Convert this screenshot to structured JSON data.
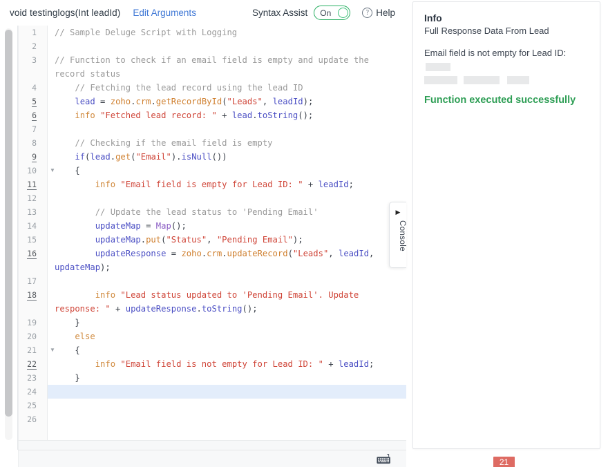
{
  "toolbar": {
    "function_signature": "void testinglogs(Int leadId)",
    "edit_arguments_label": "Edit Arguments",
    "syntax_assist_label": "Syntax Assist",
    "syntax_assist_state": "On",
    "help_label": "Help",
    "help_icon": "question-mark-circle-icon",
    "accent_link_color": "#4179d6",
    "toggle_on_color": "#27ae60"
  },
  "console": {
    "label": "Console",
    "arrow_icon": "triangle-right-icon"
  },
  "footer": {
    "keyboard_icon": "keyboard-icon"
  },
  "badge": {
    "count": "21",
    "color": "#de6b63"
  },
  "info_panel": {
    "title": "Info",
    "subtitle": "Full Response Data From Lead",
    "message_prefix": "Email field is not empty for Lead ID:",
    "success_message": "Function executed successfully",
    "success_color": "#2e9e55",
    "redacted": true
  },
  "editor": {
    "active_line": 24,
    "marked_lines": [
      5,
      6,
      9,
      11,
      16,
      18,
      22
    ],
    "fold_lines": [
      10,
      21
    ],
    "lines": [
      {
        "n": 1,
        "tokens": [
          {
            "t": "// Sample Deluge Script with Logging",
            "c": "c-com"
          }
        ]
      },
      {
        "n": 2,
        "tokens": []
      },
      {
        "n": 3,
        "tokens": [
          {
            "t": "// Function to check if an email field is empty and update the record status",
            "c": "c-com"
          }
        ]
      },
      {
        "n": 4,
        "tokens": [
          {
            "t": "    // Fetching the lead record using the lead ID",
            "c": "c-com"
          }
        ]
      },
      {
        "n": 5,
        "tokens": [
          {
            "t": "    ",
            "c": "c-pun"
          },
          {
            "t": "lead",
            "c": "c-id"
          },
          {
            "t": " = ",
            "c": "c-pun"
          },
          {
            "t": "zoho",
            "c": "c-fn"
          },
          {
            "t": ".",
            "c": "c-pun"
          },
          {
            "t": "crm",
            "c": "c-fn"
          },
          {
            "t": ".",
            "c": "c-pun"
          },
          {
            "t": "getRecordById",
            "c": "c-fn"
          },
          {
            "t": "(",
            "c": "c-pun"
          },
          {
            "t": "\"Leads\"",
            "c": "c-str"
          },
          {
            "t": ", ",
            "c": "c-pun"
          },
          {
            "t": "leadId",
            "c": "c-id"
          },
          {
            "t": ");",
            "c": "c-pun"
          }
        ]
      },
      {
        "n": 6,
        "tokens": [
          {
            "t": "    ",
            "c": "c-pun"
          },
          {
            "t": "info",
            "c": "c-log"
          },
          {
            "t": " ",
            "c": "c-pun"
          },
          {
            "t": "\"Fetched lead record: \"",
            "c": "c-str"
          },
          {
            "t": " + ",
            "c": "c-pun"
          },
          {
            "t": "lead",
            "c": "c-id"
          },
          {
            "t": ".",
            "c": "c-pun"
          },
          {
            "t": "toString",
            "c": "c-id"
          },
          {
            "t": "();",
            "c": "c-pun"
          }
        ]
      },
      {
        "n": 7,
        "tokens": []
      },
      {
        "n": 8,
        "tokens": [
          {
            "t": "    // Checking if the email field is empty",
            "c": "c-com"
          }
        ]
      },
      {
        "n": 9,
        "tokens": [
          {
            "t": "    ",
            "c": "c-pun"
          },
          {
            "t": "if",
            "c": "c-kw"
          },
          {
            "t": "(",
            "c": "c-pun"
          },
          {
            "t": "lead",
            "c": "c-id"
          },
          {
            "t": ".",
            "c": "c-pun"
          },
          {
            "t": "get",
            "c": "c-fn"
          },
          {
            "t": "(",
            "c": "c-pun"
          },
          {
            "t": "\"Email\"",
            "c": "c-str"
          },
          {
            "t": ").",
            "c": "c-pun"
          },
          {
            "t": "isNull",
            "c": "c-id"
          },
          {
            "t": "())",
            "c": "c-pun"
          }
        ]
      },
      {
        "n": 10,
        "tokens": [
          {
            "t": "    {",
            "c": "c-pun"
          }
        ]
      },
      {
        "n": 11,
        "tokens": [
          {
            "t": "        ",
            "c": "c-pun"
          },
          {
            "t": "info",
            "c": "c-log"
          },
          {
            "t": " ",
            "c": "c-pun"
          },
          {
            "t": "\"Email field is empty for Lead ID: \"",
            "c": "c-str"
          },
          {
            "t": " + ",
            "c": "c-pun"
          },
          {
            "t": "leadId",
            "c": "c-id"
          },
          {
            "t": ";",
            "c": "c-pun"
          }
        ]
      },
      {
        "n": 12,
        "tokens": []
      },
      {
        "n": 13,
        "tokens": [
          {
            "t": "        // Update the lead status to 'Pending Email'",
            "c": "c-com"
          }
        ]
      },
      {
        "n": 14,
        "tokens": [
          {
            "t": "        ",
            "c": "c-pun"
          },
          {
            "t": "updateMap",
            "c": "c-id"
          },
          {
            "t": " = ",
            "c": "c-pun"
          },
          {
            "t": "Map",
            "c": "c-type"
          },
          {
            "t": "();",
            "c": "c-pun"
          }
        ]
      },
      {
        "n": 15,
        "tokens": [
          {
            "t": "        ",
            "c": "c-pun"
          },
          {
            "t": "updateMap",
            "c": "c-id"
          },
          {
            "t": ".",
            "c": "c-pun"
          },
          {
            "t": "put",
            "c": "c-fn"
          },
          {
            "t": "(",
            "c": "c-pun"
          },
          {
            "t": "\"Status\"",
            "c": "c-str"
          },
          {
            "t": ", ",
            "c": "c-pun"
          },
          {
            "t": "\"Pending Email\"",
            "c": "c-str"
          },
          {
            "t": ");",
            "c": "c-pun"
          }
        ]
      },
      {
        "n": 16,
        "tokens": [
          {
            "t": "        ",
            "c": "c-pun"
          },
          {
            "t": "updateResponse",
            "c": "c-id"
          },
          {
            "t": " = ",
            "c": "c-pun"
          },
          {
            "t": "zoho",
            "c": "c-fn"
          },
          {
            "t": ".",
            "c": "c-pun"
          },
          {
            "t": "crm",
            "c": "c-fn"
          },
          {
            "t": ".",
            "c": "c-pun"
          },
          {
            "t": "updateRecord",
            "c": "c-fn"
          },
          {
            "t": "(",
            "c": "c-pun"
          },
          {
            "t": "\"Leads\"",
            "c": "c-str"
          },
          {
            "t": ", ",
            "c": "c-pun"
          },
          {
            "t": "leadId",
            "c": "c-id"
          },
          {
            "t": ", ",
            "c": "c-pun"
          },
          {
            "t": "updateMap",
            "c": "c-id"
          },
          {
            "t": ");",
            "c": "c-pun"
          }
        ]
      },
      {
        "n": 17,
        "tokens": []
      },
      {
        "n": 18,
        "tokens": [
          {
            "t": "        ",
            "c": "c-pun"
          },
          {
            "t": "info",
            "c": "c-log"
          },
          {
            "t": " ",
            "c": "c-pun"
          },
          {
            "t": "\"Lead status updated to 'Pending Email'. Update response: \"",
            "c": "c-str"
          },
          {
            "t": " + ",
            "c": "c-pun"
          },
          {
            "t": "updateResponse",
            "c": "c-id"
          },
          {
            "t": ".",
            "c": "c-pun"
          },
          {
            "t": "toString",
            "c": "c-id"
          },
          {
            "t": "();",
            "c": "c-pun"
          }
        ]
      },
      {
        "n": 19,
        "tokens": [
          {
            "t": "    }",
            "c": "c-pun"
          }
        ]
      },
      {
        "n": 20,
        "tokens": [
          {
            "t": "    ",
            "c": "c-pun"
          },
          {
            "t": "else",
            "c": "c-log"
          }
        ]
      },
      {
        "n": 21,
        "tokens": [
          {
            "t": "    {",
            "c": "c-pun"
          }
        ]
      },
      {
        "n": 22,
        "tokens": [
          {
            "t": "        ",
            "c": "c-pun"
          },
          {
            "t": "info",
            "c": "c-log"
          },
          {
            "t": " ",
            "c": "c-pun"
          },
          {
            "t": "\"Email field is not empty for Lead ID: \"",
            "c": "c-str"
          },
          {
            "t": " + ",
            "c": "c-pun"
          },
          {
            "t": "leadId",
            "c": "c-id"
          },
          {
            "t": ";",
            "c": "c-pun"
          }
        ]
      },
      {
        "n": 23,
        "tokens": [
          {
            "t": "    }",
            "c": "c-pun"
          }
        ]
      },
      {
        "n": 24,
        "tokens": []
      },
      {
        "n": 25,
        "tokens": []
      },
      {
        "n": 26,
        "tokens": []
      }
    ]
  }
}
